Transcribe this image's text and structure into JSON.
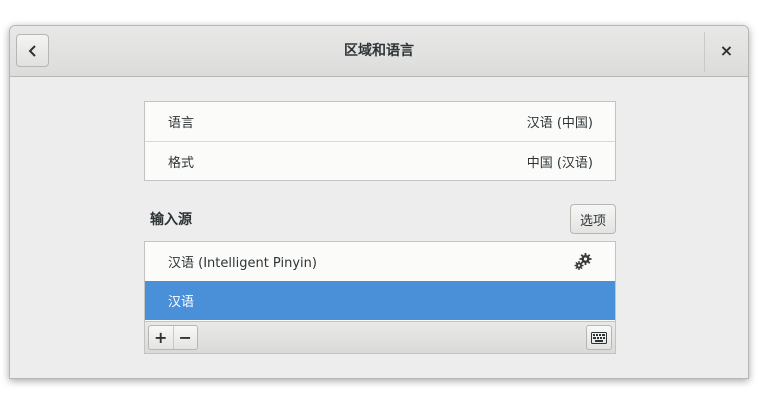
{
  "window": {
    "title": "区域和语言",
    "back_icon": "chevron-left-icon",
    "close_label": "×"
  },
  "settings": {
    "rows": [
      {
        "label": "语言",
        "value": "汉语 (中国)"
      },
      {
        "label": "格式",
        "value": "中国 (汉语)"
      }
    ]
  },
  "input_sources": {
    "title": "输入源",
    "options_label": "选项",
    "items": [
      {
        "label": "汉语 (Intelligent Pinyin)",
        "icon": "gear-icon",
        "selected": false
      },
      {
        "label": "汉语",
        "selected": true
      }
    ],
    "toolbar": {
      "add_label": "+",
      "remove_label": "−",
      "keyboard_icon": "keyboard-icon"
    }
  },
  "colors": {
    "selection": "#4a90d9",
    "window_bg": "#ededed"
  }
}
